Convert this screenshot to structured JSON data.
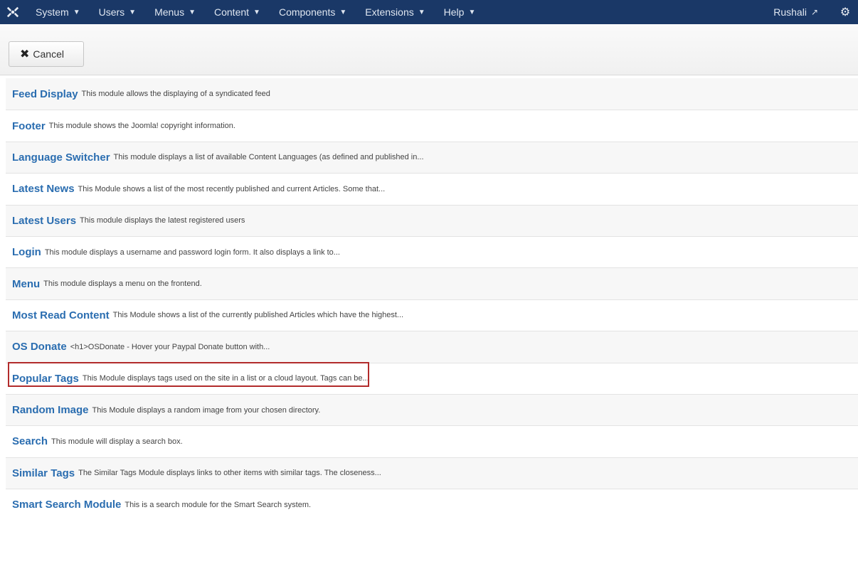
{
  "navbar": {
    "logo_icon": "joomla-logo-icon",
    "menus": [
      {
        "label": "System",
        "caret": "▼"
      },
      {
        "label": "Users",
        "caret": "▼"
      },
      {
        "label": "Menus",
        "caret": "▼"
      },
      {
        "label": "Content",
        "caret": "▼"
      },
      {
        "label": "Components",
        "caret": "▼"
      },
      {
        "label": "Extensions",
        "caret": "▼"
      },
      {
        "label": "Help",
        "caret": "▼"
      }
    ],
    "user": "Rushali",
    "user_icon": "external-link-icon",
    "settings_icon": "gear-icon",
    "background": "#1a3867"
  },
  "toolbar": {
    "cancel_label": "Cancel",
    "cancel_icon": "close-icon"
  },
  "modules": [
    {
      "title": "Feed Display",
      "desc": "This module allows the displaying of a syndicated feed"
    },
    {
      "title": "Footer",
      "desc": "This module shows the Joomla! copyright information."
    },
    {
      "title": "Language Switcher",
      "desc": "This module displays a list of available Content Languages (as defined and published in..."
    },
    {
      "title": "Latest News",
      "desc": "This Module shows a list of the most recently published and current Articles. Some that..."
    },
    {
      "title": "Latest Users",
      "desc": "This module displays the latest registered users"
    },
    {
      "title": "Login",
      "desc": "This module displays a username and password login form. It also displays a link to..."
    },
    {
      "title": "Menu",
      "desc": "This module displays a menu on the frontend."
    },
    {
      "title": "Most Read Content",
      "desc": "This Module shows a list of the currently published Articles which have the highest..."
    },
    {
      "title": "OS Donate",
      "desc": "<h1>OSDonate - Hover your Paypal Donate button with..."
    },
    {
      "title": "Popular Tags",
      "desc": "This Module displays tags used on the site in a list or a cloud layout. Tags can be..."
    },
    {
      "title": "Random Image",
      "desc": "This Module displays a random image from your chosen directory."
    },
    {
      "title": "Search",
      "desc": "This module will display a search box."
    },
    {
      "title": "Similar Tags",
      "desc": "The Similar Tags Module displays links to other items with similar tags. The closeness..."
    },
    {
      "title": "Smart Search Module",
      "desc": "This is a search module for the Smart Search system."
    }
  ],
  "highlight_color": "#b22b2b",
  "link_color": "#2a6db0"
}
